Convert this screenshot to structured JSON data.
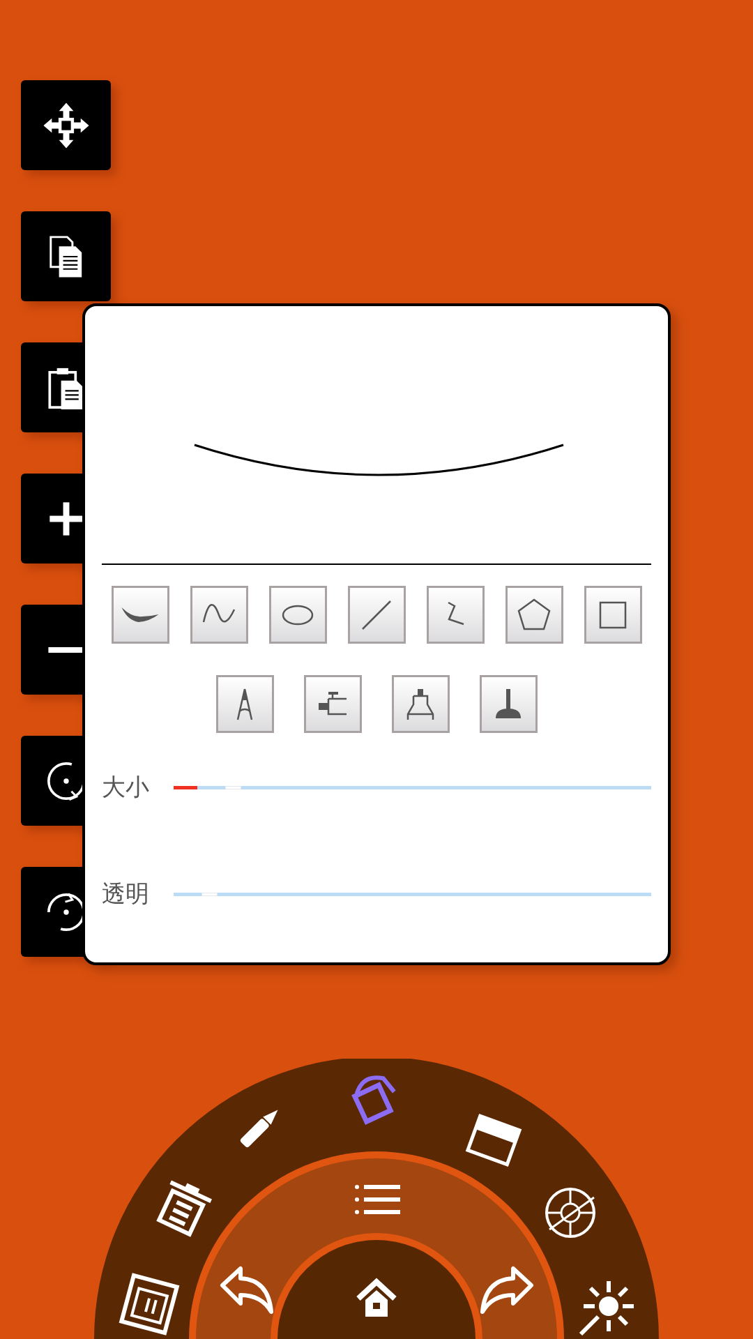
{
  "side_toolbar": [
    {
      "kind": "move"
    },
    {
      "kind": "copy"
    },
    {
      "kind": "paste"
    },
    {
      "kind": "zoom_in"
    },
    {
      "kind": "zoom_out"
    },
    {
      "kind": "rotate_right"
    },
    {
      "kind": "rotate_left"
    }
  ],
  "brush_panel": {
    "shape_tools": [
      {
        "kind": "stroke"
      },
      {
        "kind": "wave"
      },
      {
        "kind": "ellipse"
      },
      {
        "kind": "line"
      },
      {
        "kind": "zigzag"
      },
      {
        "kind": "pentagon"
      },
      {
        "kind": "square"
      }
    ],
    "pen_tools": [
      {
        "kind": "nib"
      },
      {
        "kind": "airbrush"
      },
      {
        "kind": "marker"
      },
      {
        "kind": "stamp"
      }
    ],
    "sliders": [
      {
        "label": "大小",
        "level": 0.05
      },
      {
        "label": "透明",
        "level": 0
      }
    ]
  },
  "radial_menu": {
    "tools": [
      {
        "kind": "bucket",
        "selected": true
      },
      {
        "kind": "pencil",
        "selected": false
      },
      {
        "kind": "eraser",
        "selected": false
      },
      {
        "kind": "trash",
        "selected": false
      },
      {
        "kind": "color_wheel",
        "selected": false
      },
      {
        "kind": "page",
        "selected": false
      },
      {
        "kind": "light",
        "selected": false
      }
    ],
    "inner": [
      {
        "kind": "list"
      },
      {
        "kind": "undo"
      },
      {
        "kind": "redo"
      },
      {
        "kind": "home"
      }
    ]
  }
}
